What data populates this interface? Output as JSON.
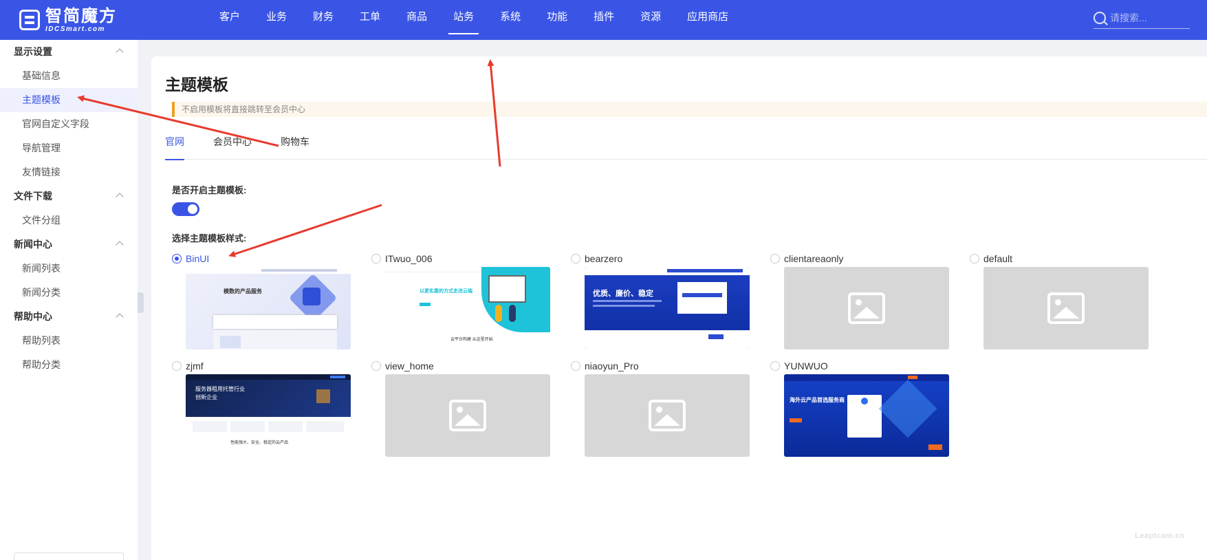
{
  "brand": {
    "name_cn": "智简魔方",
    "name_en": "IDCSmart.com"
  },
  "nav": {
    "items": [
      "客户",
      "业务",
      "财务",
      "工单",
      "商品",
      "站务",
      "系统",
      "功能",
      "插件",
      "资源",
      "应用商店"
    ],
    "active": "站务"
  },
  "search": {
    "placeholder": "请搜索..."
  },
  "sidebar": {
    "groups": [
      {
        "title": "显示设置",
        "items": [
          "基础信息",
          "主题模板",
          "官网自定义字段",
          "导航管理",
          "友情链接"
        ]
      },
      {
        "title": "文件下载",
        "items": [
          "文件分组"
        ]
      },
      {
        "title": "新闻中心",
        "items": [
          "新闻列表",
          "新闻分类"
        ]
      },
      {
        "title": "帮助中心",
        "items": [
          "帮助列表",
          "帮助分类"
        ]
      }
    ],
    "active_item": "主题模板"
  },
  "page": {
    "title": "主题模板",
    "notice": "不启用模板将直接跳转至会员中心",
    "tabs": [
      "官网",
      "会员中心",
      "购物车"
    ],
    "active_tab": "官网",
    "enable_label": "是否开启主题模板:",
    "enable_value": true,
    "style_label": "选择主题模板样式:"
  },
  "themes": [
    {
      "name": "BinUI",
      "checked": true,
      "thumb": "binui"
    },
    {
      "name": "ITwuo_006",
      "checked": false,
      "thumb": "itwuo"
    },
    {
      "name": "bearzero",
      "checked": false,
      "thumb": "bear"
    },
    {
      "name": "clientareaonly",
      "checked": false,
      "thumb": "placeholder"
    },
    {
      "name": "default",
      "checked": false,
      "thumb": "placeholder"
    },
    {
      "name": "zjmf",
      "checked": false,
      "thumb": "zjmf"
    },
    {
      "name": "view_home",
      "checked": false,
      "thumb": "placeholder"
    },
    {
      "name": "niaoyun_Pro",
      "checked": false,
      "thumb": "placeholder"
    },
    {
      "name": "YUNWUO",
      "checked": false,
      "thumb": "yun"
    }
  ],
  "thumb_text": {
    "binui": "模数的产品服务",
    "itwuo_title": "以更实惠的方式走进云端",
    "itwuo_sub": "云平台构建 从这里开始",
    "bear": "优质、廉价、稳定",
    "zjmf_title": "服务器租用托管行业",
    "zjmf_sub": "创新企业",
    "zjmf_bottom": "性能强大、安全、稳定的云产品",
    "yun": "海外云产品首选服务商"
  },
  "watermark": "Leaptcam.cn",
  "colors": {
    "primary": "#3a55e6",
    "warning": "#f0a020",
    "annotation": "#e83a2e"
  }
}
